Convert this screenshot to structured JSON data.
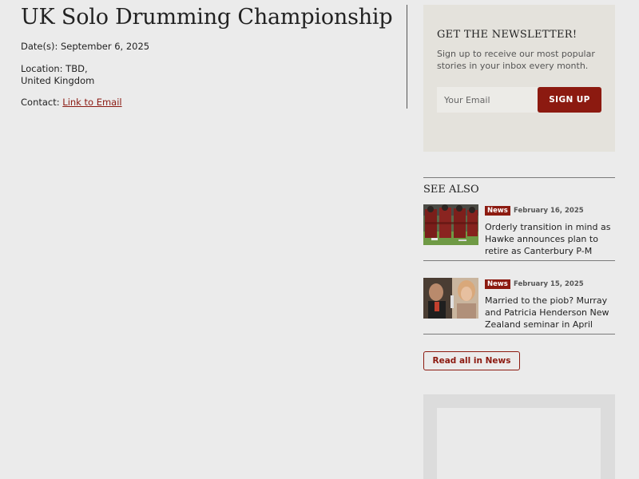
{
  "event": {
    "title": "UK Solo Drumming Championship",
    "date_label": "Date(s):",
    "date_value": "September 6, 2025",
    "location_label": "Location:",
    "location_line1": "TBD,",
    "location_line2": "United Kingdom",
    "contact_label": "Contact:",
    "contact_link": "Link to Email"
  },
  "newsletter": {
    "title": "GET THE NEWSLETTER!",
    "description": "Sign up to receive our most popular stories in your inbox every month.",
    "email_placeholder": "Your Email",
    "signup_label": "SIGN UP"
  },
  "see_also": {
    "title": "SEE ALSO",
    "articles": [
      {
        "category": "News",
        "date": "February 16, 2025",
        "title": "Orderly transition in mind as Hawke announces plan to retire as Canterbury P-M",
        "thumb_icon": "pipe-band-photo"
      },
      {
        "category": "News",
        "date": "February 15, 2025",
        "title": "Married to the piob? Murray and Patricia Henderson New Zealand seminar in April",
        "thumb_icon": "couple-photo"
      }
    ],
    "read_all_label": "Read all in News"
  },
  "colors": {
    "accent": "#8c1a10",
    "page_background": "#ebebeb",
    "newsletter_background": "#e4e2dc"
  }
}
